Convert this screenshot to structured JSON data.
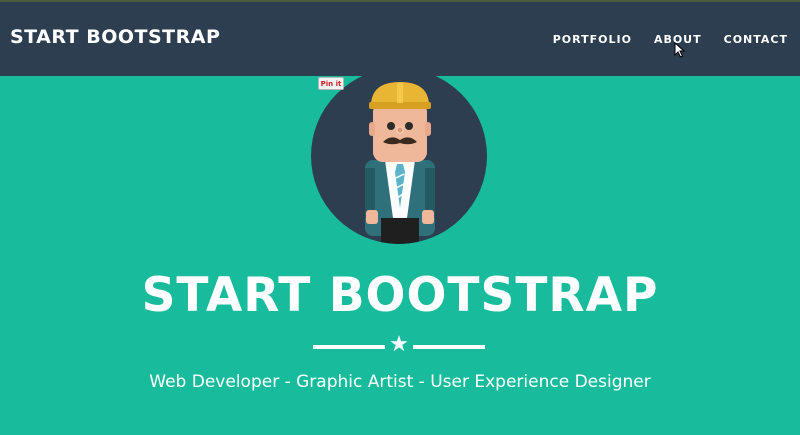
{
  "navbar": {
    "brand": "START BOOTSTRAP",
    "links": [
      "PORTFOLIO",
      "ABOUT",
      "CONTACT"
    ]
  },
  "hero": {
    "pin_button": "Pin it",
    "title": "START BOOTSTRAP",
    "subtitle": "Web Developer - Graphic Artist - User Experience Designer",
    "divider_icon": "star-icon"
  },
  "colors": {
    "navbar_bg": "#2c3e50",
    "hero_bg": "#18bc9c",
    "text": "#ffffff"
  }
}
